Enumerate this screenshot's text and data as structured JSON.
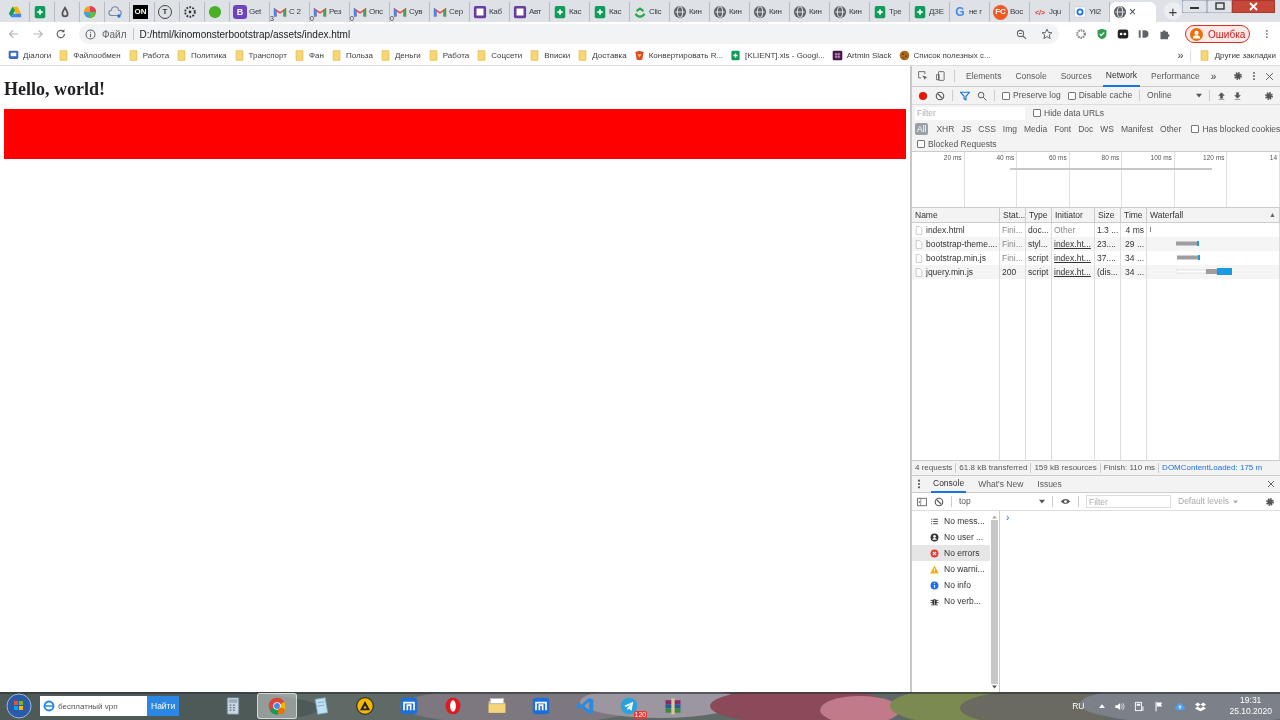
{
  "tabs": [
    {
      "kind": "drive",
      "selected": false
    },
    {
      "kind": "sheets",
      "selected": false
    },
    {
      "kind": "drop",
      "selected": false
    },
    {
      "kind": "palette",
      "selected": false
    },
    {
      "kind": "cloud",
      "selected": false
    },
    {
      "kind": "square-glyph",
      "glyph": "ON",
      "selected": false
    },
    {
      "kind": "circle-glyph",
      "glyph": "T",
      "selected": false
    },
    {
      "kind": "dots",
      "selected": false
    },
    {
      "kind": "greendot",
      "selected": false
    },
    {
      "kind": "purple-glyph",
      "glyph": "B",
      "title": "Get",
      "selected": false
    },
    {
      "kind": "gmail",
      "badge": "3",
      "title": "C 2",
      "selected": false
    },
    {
      "kind": "gmail",
      "badge": "0",
      "title": "Рез",
      "selected": false
    },
    {
      "kind": "gmail",
      "badge": "0",
      "title": "Опс",
      "selected": false
    },
    {
      "kind": "gmail",
      "badge": "0",
      "title": "Сув",
      "selected": false
    },
    {
      "kind": "gmail",
      "title": "Сер",
      "selected": false
    },
    {
      "kind": "purple",
      "title": "Каб",
      "selected": false
    },
    {
      "kind": "purple",
      "title": "Авт",
      "selected": false
    },
    {
      "kind": "sheets",
      "title": "Кас",
      "selected": false
    },
    {
      "kind": "sheets",
      "title": "Кас",
      "selected": false
    },
    {
      "kind": "clickup",
      "title": "Clic",
      "selected": false
    },
    {
      "kind": "globe",
      "title": "Кин",
      "selected": false
    },
    {
      "kind": "globe",
      "title": "Кин",
      "selected": false
    },
    {
      "kind": "globe",
      "title": "Кин",
      "selected": false
    },
    {
      "kind": "globe",
      "title": "Кин",
      "selected": false
    },
    {
      "kind": "globe",
      "title": "Кин",
      "selected": false
    },
    {
      "kind": "sheets",
      "title": "Тре",
      "selected": false
    },
    {
      "kind": "sheets",
      "title": "ДЗЕ",
      "selected": false
    },
    {
      "kind": "google-glyph",
      "glyph": "G",
      "title": "не г",
      "selected": false
    },
    {
      "kind": "orange-glyph",
      "glyph": "FC",
      "title": "Вос",
      "selected": false
    },
    {
      "kind": "code-glyph",
      "glyph": "</>",
      "title": "Jqu",
      "selected": false
    },
    {
      "kind": "yii",
      "title": "Yii2",
      "selected": false
    },
    {
      "kind": "globe",
      "close": "×",
      "selected": true
    }
  ],
  "new_tab": "+",
  "toolbar": {
    "origin_label": "Файл",
    "url": "D:/html/kinomonsterbootstrap/assets/index.html",
    "profile": "Ошибка"
  },
  "bookmarks": [
    {
      "kind": "app",
      "label": "Діалоги"
    },
    {
      "kind": "folder",
      "label": "Файлообмен"
    },
    {
      "kind": "folder",
      "label": "Работа"
    },
    {
      "kind": "folder",
      "label": "Политика"
    },
    {
      "kind": "folder",
      "label": "Транспорт"
    },
    {
      "kind": "folder",
      "label": "Фан"
    },
    {
      "kind": "folder",
      "label": "Польза"
    },
    {
      "kind": "folder",
      "label": "Деньги"
    },
    {
      "kind": "folder",
      "label": "Работа"
    },
    {
      "kind": "folder",
      "label": "Соцсети"
    },
    {
      "kind": "folder",
      "label": "Вписки"
    },
    {
      "kind": "folder",
      "label": "Доставка"
    },
    {
      "kind": "convert",
      "label": "Конвертировать R..."
    },
    {
      "kind": "sheets",
      "label": "[KLIENT].xls - Googl..."
    },
    {
      "kind": "slack",
      "label": "Artmin Slack"
    },
    {
      "kind": "cookie",
      "label": "Список полезных с..."
    }
  ],
  "bookmarks_overflow": "»",
  "other_bookmarks": "Другие закладки",
  "page": {
    "heading": "Hello, world!"
  },
  "devtools": {
    "panels": [
      {
        "label": "Elements",
        "selected": false
      },
      {
        "label": "Console",
        "selected": false
      },
      {
        "label": "Sources",
        "selected": false
      },
      {
        "label": "Network",
        "selected": true
      },
      {
        "label": "Performance",
        "selected": false
      }
    ],
    "more_panels": "»",
    "network": {
      "preserve_log": {
        "label": "Preserve log",
        "checked": false
      },
      "disable_cache": {
        "label": "Disable cache",
        "checked": false
      },
      "throttling": "Online",
      "filter_placeholder": "Filter",
      "hide_data_urls": {
        "label": "Hide data URLs",
        "checked": false
      },
      "types": [
        {
          "label": "All",
          "selected": true
        },
        {
          "label": "XHR",
          "selected": false
        },
        {
          "label": "JS",
          "selected": false
        },
        {
          "label": "CSS",
          "selected": false
        },
        {
          "label": "Img",
          "selected": false
        },
        {
          "label": "Media",
          "selected": false
        },
        {
          "label": "Font",
          "selected": false
        },
        {
          "label": "Doc",
          "selected": false
        },
        {
          "label": "WS",
          "selected": false
        },
        {
          "label": "Manifest",
          "selected": false
        },
        {
          "label": "Other",
          "selected": false
        }
      ],
      "has_blocked_cookies": {
        "label": "Has blocked cookies",
        "checked": false
      },
      "blocked_requests": {
        "label": "Blocked Requests",
        "checked": false
      },
      "overview_ticks": [
        "20 ms",
        "40 ms",
        "60 ms",
        "80 ms",
        "100 ms",
        "120 ms",
        "14"
      ],
      "columns": [
        "Name",
        "Stat...",
        "Type",
        "Initiator",
        "Size",
        "Time",
        "Waterfall"
      ],
      "sort_indicator": "▲",
      "requests": [
        {
          "name": "index.html",
          "status": "Fini...",
          "type": "doc...",
          "initiator": "Other",
          "initiator_link": false,
          "size": "1.3 ...",
          "time": "4 ms"
        },
        {
          "name": "bootstrap-theme....",
          "status": "Fini...",
          "type": "styl...",
          "initiator": "index.ht...",
          "initiator_link": true,
          "size": "23....",
          "time": "29 ..."
        },
        {
          "name": "bootstrap.min.js",
          "status": "Fini...",
          "type": "script",
          "initiator": "index.ht...",
          "initiator_link": true,
          "size": "37....",
          "time": "34 ..."
        },
        {
          "name": "jquery.min.js",
          "status": "200",
          "type": "script",
          "initiator": "index.ht...",
          "initiator_link": true,
          "size": "(dis...",
          "time": "34 ..."
        }
      ],
      "summary": [
        "4 requests",
        "61.8 kB transferred",
        "159 kB resources",
        "Finish: 110 ms",
        "DOMContentLoaded: 175 m"
      ]
    },
    "drawer": {
      "tabs": [
        {
          "label": "Console",
          "selected": true
        },
        {
          "label": "What's New",
          "selected": false
        },
        {
          "label": "Issues",
          "selected": false
        }
      ],
      "context": "top",
      "filter_placeholder": "Filter",
      "levels": "Default levels",
      "sidebar": [
        {
          "kind": "messages",
          "label": "No mess...",
          "selected": false
        },
        {
          "kind": "user",
          "label": "No user ...",
          "selected": false
        },
        {
          "kind": "errors",
          "label": "No errors",
          "selected": true
        },
        {
          "kind": "warnings",
          "label": "No warni...",
          "selected": false
        },
        {
          "kind": "info",
          "label": "No info",
          "selected": false
        },
        {
          "kind": "verbose",
          "label": "No verb...",
          "selected": false
        }
      ],
      "prompt": "›"
    }
  },
  "taskbar": {
    "search_value": "бесплатный vpn",
    "search_button": "Найти",
    "apps": [
      {
        "kind": "calculator",
        "active": false
      },
      {
        "kind": "chrome",
        "active": true
      },
      {
        "kind": "notepad",
        "active": false
      },
      {
        "kind": "aimp",
        "active": false
      },
      {
        "kind": "maxthon",
        "active": false
      },
      {
        "kind": "opera",
        "active": false
      },
      {
        "kind": "explorer",
        "active": false
      },
      {
        "kind": "maxthon",
        "active": false
      },
      {
        "kind": "vscode",
        "active": false
      },
      {
        "kind": "telegram",
        "badge": "120",
        "active": false
      },
      {
        "kind": "winrar",
        "active": false
      }
    ],
    "language": "RU",
    "time": "19:31",
    "date": "25.10.2020"
  }
}
